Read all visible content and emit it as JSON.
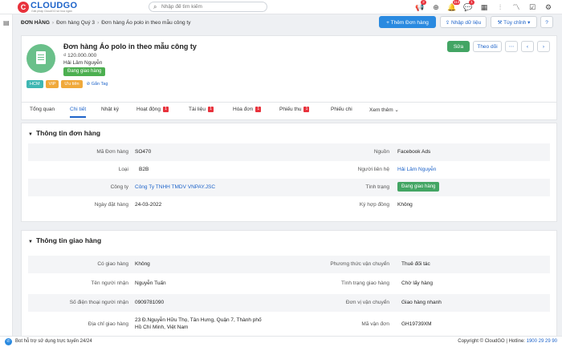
{
  "app": {
    "logo_text": "CLOUDGO",
    "logo_sub": "Giải pháp CloudGO số hóa ngân",
    "search_placeholder": "Nhập để tìm kiếm",
    "notification_badges": [
      "2",
      "114",
      "1"
    ]
  },
  "breadcrumb": {
    "root": "ĐƠN HÀNG",
    "level1": "Đơn hàng Quý 3",
    "level2": "Đơn hàng Áo polo in theo mẫu công ty"
  },
  "toolbar": {
    "add_label": "+ Thêm Đơn hàng",
    "import_label": "Nhập dữ liệu",
    "custom_label": "Tùy chỉnh"
  },
  "record": {
    "title": "Đơn hàng Áo polo in theo mẫu công ty",
    "price": "₫ 120.000.000",
    "owner": "Hải Lâm Nguyễn",
    "status": "Đang giao hàng",
    "edit_label": "Sửa",
    "follow_label": "Theo dõi",
    "tags": [
      {
        "label": "HCM",
        "color": "#3fb7b3"
      },
      {
        "label": "VIP",
        "color": "#f0a93b"
      },
      {
        "label": "Ưu tiên",
        "color": "#f0a93b"
      }
    ],
    "add_tag_label": "Gắn Tag"
  },
  "tabs": [
    {
      "label": "Tổng quan"
    },
    {
      "label": "Chi tiết"
    },
    {
      "label": "Nhật ký"
    },
    {
      "label": "Hoạt động",
      "count": "1"
    },
    {
      "label": "Tài liệu",
      "count": "1"
    },
    {
      "label": "Hóa đơn",
      "count": "1"
    },
    {
      "label": "Phiếu thu",
      "count": "1"
    },
    {
      "label": "Phiếu chi"
    },
    {
      "label": "Xem thêm"
    }
  ],
  "order_info": {
    "title": "Thông tin đơn hàng",
    "left": [
      {
        "label": "Mã Đơn hàng",
        "value": "SO470"
      },
      {
        "label": "Loại",
        "value": "B2B"
      },
      {
        "label": "Công ty",
        "value": "Công Ty TNHH TMDV VNPAY.JSC"
      },
      {
        "label": "Ngày đặt hàng",
        "value": "24-03-2022"
      }
    ],
    "right": [
      {
        "label": "Nguồn",
        "value": "Facebook Ads"
      },
      {
        "label": "Người liên hệ",
        "value": "Hải Lâm Nguyễn"
      },
      {
        "label": "Tình trạng",
        "value": "Đang giao hàng"
      },
      {
        "label": "Ký hợp đồng",
        "value": "Không"
      }
    ]
  },
  "shipping_info": {
    "title": "Thông tin giao hàng",
    "left": [
      {
        "label": "Có giao hàng",
        "value": "Không"
      },
      {
        "label": "Tên người nhận",
        "value": "Nguyễn Tuấn"
      },
      {
        "label": "Số điện thoại người nhận",
        "value": "0909781090"
      },
      {
        "label": "Địa chỉ giao hàng",
        "value": "23 Đ.Nguyễn Hữu Thọ, Tân Hưng, Quận 7, Thành phố",
        "value2": "Hồ Chí Minh, Việt Nam"
      }
    ],
    "right": [
      {
        "label": "Phương thức vận chuyển",
        "value": "Thuê đối tác"
      },
      {
        "label": "Tình trạng giao hàng",
        "value": "Chờ lấy hàng"
      },
      {
        "label": "Đơn vị vận chuyển",
        "value": "Giao hàng nhanh"
      },
      {
        "label": "Mã vận đơn",
        "value": "GH19739XM"
      }
    ]
  },
  "footer": {
    "support": "Bot hỗ trợ sử dụng trực tuyến 24/24",
    "copyright": "Copyright © CloudGO | Hotline:",
    "hotline": "1900 29 29 90"
  }
}
